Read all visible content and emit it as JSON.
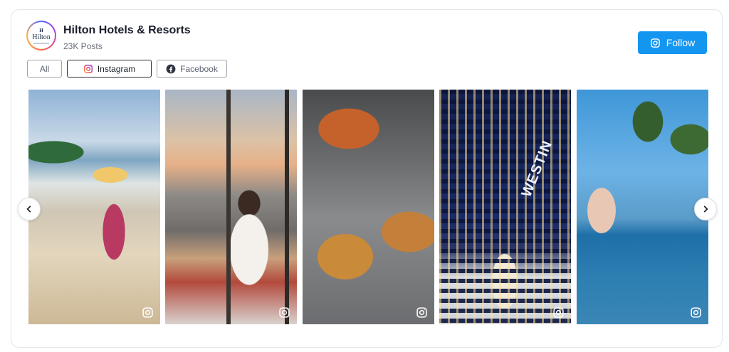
{
  "profile": {
    "name": "Hilton Hotels & Resorts",
    "posts": "23K Posts",
    "logo_text": "Hilton",
    "logo_mark": "H"
  },
  "follow_button": {
    "label": "Follow"
  },
  "filters": [
    {
      "label": "All",
      "active": false
    },
    {
      "label": "Instagram",
      "active": true,
      "icon": "instagram-icon"
    },
    {
      "label": "Facebook",
      "active": false,
      "icon": "facebook-icon"
    }
  ],
  "tiles": [
    {
      "source": "instagram-icon"
    },
    {
      "source": "instagram-icon"
    },
    {
      "source": "instagram-icon"
    },
    {
      "source": "instagram-icon",
      "sign_text": "WESTIN"
    },
    {
      "source": "instagram-icon"
    }
  ],
  "colors": {
    "accent": "#1496f0",
    "text": "#1b1f2b",
    "muted": "#6a6f7c",
    "border": "#e3e5ea"
  }
}
